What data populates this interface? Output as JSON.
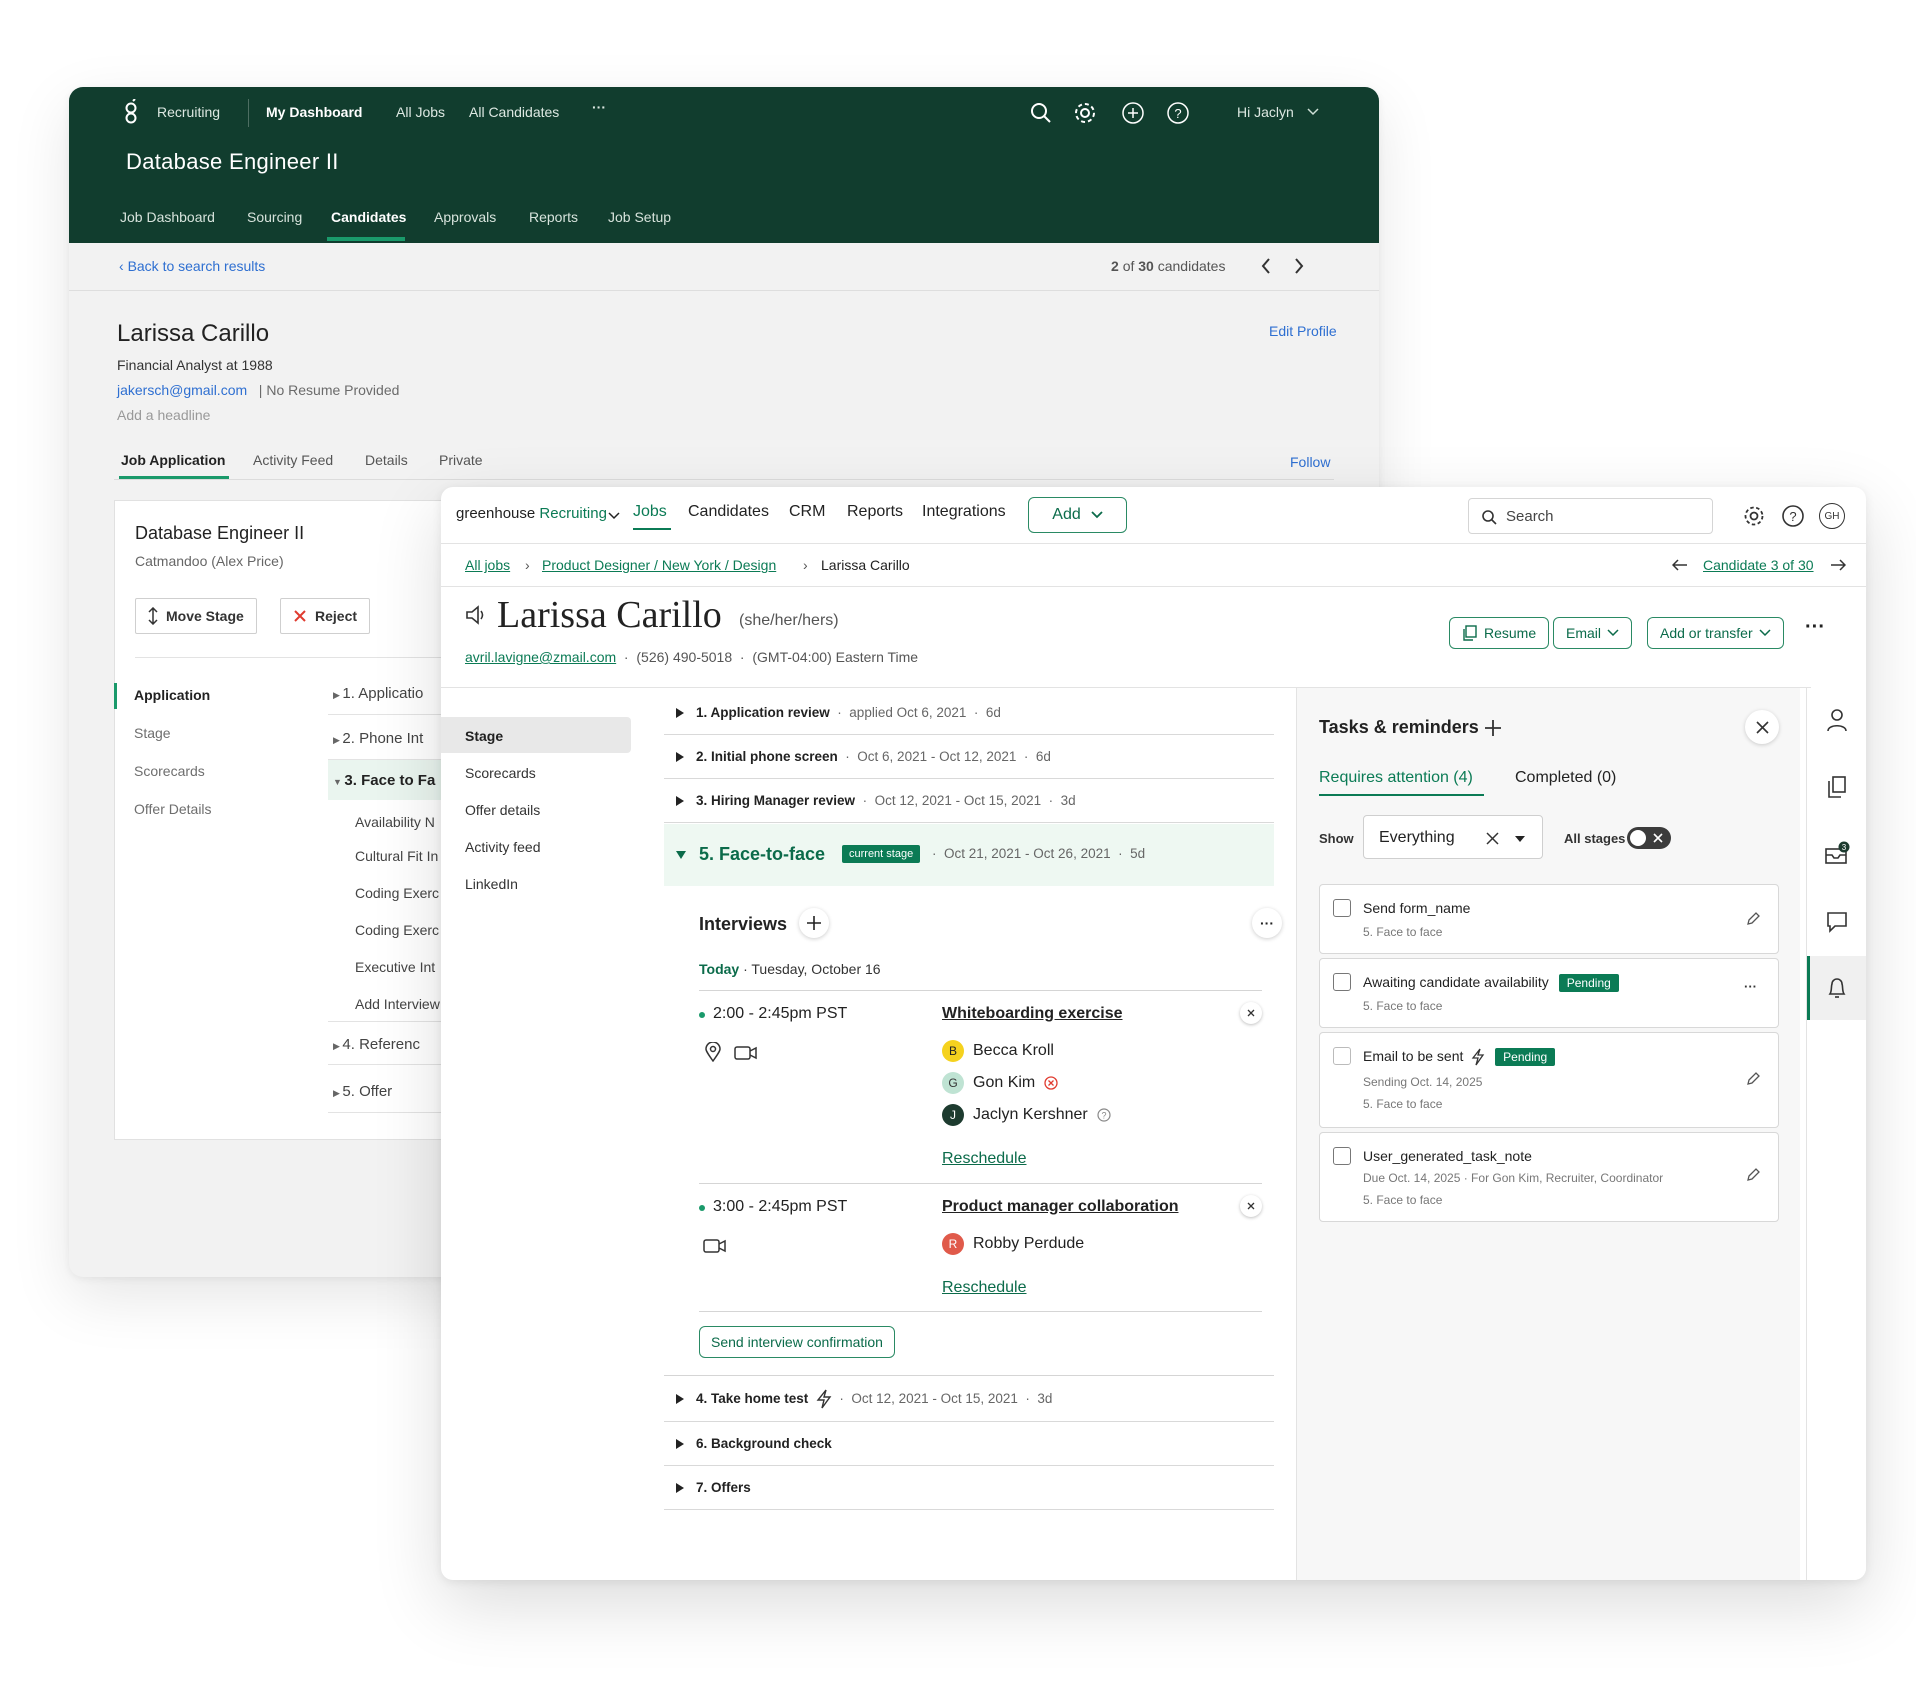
{
  "back": {
    "app_label": "Recruiting",
    "nav": [
      "My Dashboard",
      "All Jobs",
      "All Candidates"
    ],
    "nav_more": "···",
    "greeting": "Hi Jaclyn",
    "job_title": "Database Engineer II",
    "tabs": [
      "Job Dashboard",
      "Sourcing",
      "Candidates",
      "Approvals",
      "Reports",
      "Job Setup"
    ],
    "back_link": "Back to search results",
    "pager": {
      "current": "2",
      "of": "of",
      "total": "30",
      "suffix": "candidates"
    },
    "candidate": {
      "name": "Larissa Carillo",
      "role": "Financial Analyst at 1988",
      "email": "jakersch@gmail.com",
      "resume": "No Resume Provided",
      "headline": "Add a headline",
      "edit": "Edit Profile",
      "follow": "Follow"
    },
    "profile_tabs": [
      "Job Application",
      "Activity Feed",
      "Details",
      "Private"
    ],
    "job_card": {
      "title": "Database Engineer II",
      "sub": "Catmandoo (Alex Price)",
      "move": "Move Stage",
      "reject": "Reject"
    },
    "side": [
      "Application",
      "Stage",
      "Scorecards",
      "Offer Details"
    ],
    "stages": [
      "1. Applicatio",
      "2. Phone Int",
      "3. Face to Fa",
      "4. Referenc",
      "5. Offer"
    ],
    "sub": [
      "Availability N",
      "Cultural Fit In",
      "Coding Exerc",
      "Coding Exerc",
      "Executive Int",
      "Add Interview"
    ]
  },
  "front": {
    "brand": "greenhouse",
    "brand_sub": "Recruiting",
    "nav": [
      "Jobs",
      "Candidates",
      "CRM",
      "Reports",
      "Integrations"
    ],
    "add": "Add",
    "search_placeholder": "Search",
    "avatar": "GH",
    "crumbs": [
      "All jobs",
      "Product Designer / New York / Design",
      "Larissa Carillo"
    ],
    "candidate_nav": "Candidate 3 of 30",
    "name": "Larissa Carillo",
    "pronouns": "(she/her/hers)",
    "email": "avril.lavigne@zmail.com",
    "phone": "(526) 490-5018",
    "tz": "(GMT-04:00) Eastern Time",
    "actions": {
      "resume": "Resume",
      "email": "Email",
      "transfer": "Add or transfer",
      "more": "···"
    },
    "leftnav": [
      "Stage",
      "Scorecards",
      "Offer details",
      "Activity feed",
      "LinkedIn"
    ],
    "stages": [
      {
        "title": "1. Application review",
        "meta": "applied Oct 6, 2021",
        "dur": "6d"
      },
      {
        "title": "2. Initial phone screen",
        "meta": "Oct 6, 2021 - Oct 12, 2021",
        "dur": "6d"
      },
      {
        "title": "3. Hiring Manager review",
        "meta": "Oct 12, 2021 - Oct 15, 2021",
        "dur": "3d"
      }
    ],
    "current": {
      "title": "5. Face-to-face",
      "badge": "current stage",
      "meta": "Oct 21, 2021 - Oct 26, 2021",
      "dur": "5d"
    },
    "interviews_label": "Interviews",
    "today": "Today",
    "today_date": "· Tuesday, October 16",
    "interviews": [
      {
        "time": "2:00 - 2:45pm PST",
        "title": "Whiteboarding exercise",
        "reschedule": "Reschedule",
        "people": [
          {
            "initial": "B",
            "name": "Becca Kroll",
            "color": "#f5d21e"
          },
          {
            "initial": "G",
            "name": "Gon Kim",
            "color": "#bfe3d3"
          },
          {
            "initial": "J",
            "name": "Jaclyn Kershner",
            "color": "#1d3b2f"
          }
        ]
      },
      {
        "time": "3:00 - 2:45pm PST",
        "title": "Product manager collaboration",
        "reschedule": "Reschedule",
        "people": [
          {
            "initial": "R",
            "name": "Robby Perdude",
            "color": "#e05a4a"
          }
        ]
      }
    ],
    "send_confirmation": "Send interview confirmation",
    "later_stages": [
      {
        "title": "4. Take home test",
        "meta": "Oct 12, 2021 - Oct 15, 2021",
        "dur": "3d"
      },
      {
        "title": "6. Background check"
      },
      {
        "title": "7. Offers"
      }
    ],
    "tasks": {
      "title": "Tasks & reminders",
      "tab_attention": "Requires attention (4)",
      "tab_completed": "Completed (0)",
      "show": "Show",
      "filter": "Everything",
      "all_stages": "All stages",
      "items": [
        {
          "title": "Send form_name",
          "sub": "5. Face to face"
        },
        {
          "title": "Awaiting candidate availability",
          "badge": "Pending",
          "sub": "5. Face to face"
        },
        {
          "title": "Email to be sent",
          "badge": "Pending",
          "sub0": "Sending Oct. 14, 2025",
          "sub": "5. Face to face"
        },
        {
          "title": "User_generated_task_note",
          "sub0": "Due Oct. 14, 2025 · For Gon Kim, Recruiter, Coordinator",
          "sub": "5. Face to face"
        }
      ]
    },
    "rail_badge": "3",
    "colors": {
      "accent": "#0b7b55",
      "dark_header": "#113d2e"
    }
  }
}
